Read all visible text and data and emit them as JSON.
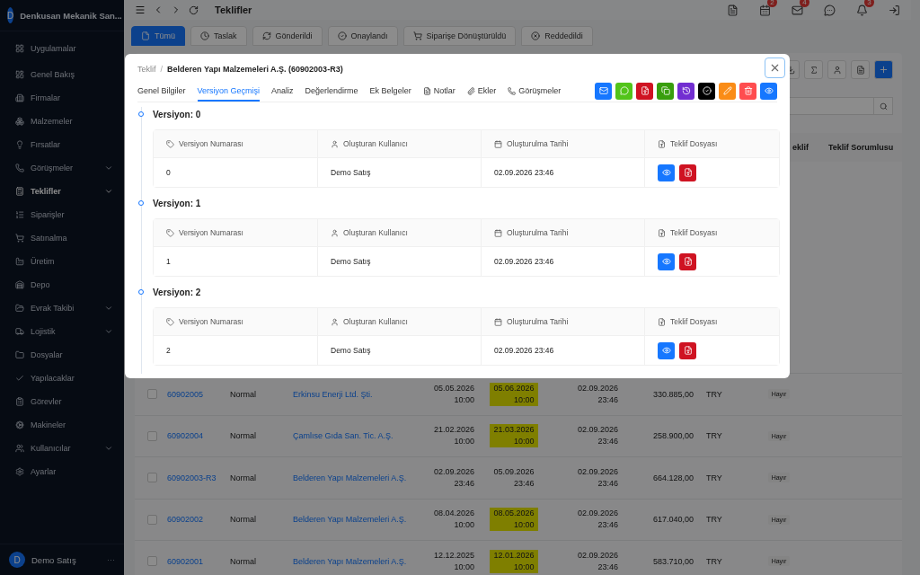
{
  "sidebar": {
    "company": {
      "avatar": "D",
      "name": "Denkusan Mekanik San..."
    },
    "items": [
      {
        "label": "Uygulamalar",
        "expandable": false,
        "selected": false
      },
      {
        "label": "Genel Bakış",
        "expandable": false,
        "selected": false
      },
      {
        "label": "Firmalar",
        "expandable": false,
        "selected": false
      },
      {
        "label": "Malzemeler",
        "expandable": false,
        "selected": false
      },
      {
        "label": "Fırsatlar",
        "expandable": false,
        "selected": false
      },
      {
        "label": "Görüşmeler",
        "expandable": true,
        "selected": false
      },
      {
        "label": "Teklifler",
        "expandable": true,
        "selected": true
      },
      {
        "label": "Siparişler",
        "expandable": false,
        "selected": false
      },
      {
        "label": "Satınalma",
        "expandable": false,
        "selected": false
      },
      {
        "label": "Üretim",
        "expandable": false,
        "selected": false
      },
      {
        "label": "Depo",
        "expandable": false,
        "selected": false
      },
      {
        "label": "Evrak Takibi",
        "expandable": true,
        "selected": false
      },
      {
        "label": "Lojistik",
        "expandable": true,
        "selected": false
      },
      {
        "label": "Dosyalar",
        "expandable": false,
        "selected": false
      },
      {
        "label": "Yapılacaklar",
        "expandable": false,
        "selected": false
      },
      {
        "label": "Görevler",
        "expandable": false,
        "selected": false
      },
      {
        "label": "Makineler",
        "expandable": false,
        "selected": false
      },
      {
        "label": "Kullanıcılar",
        "expandable": true,
        "selected": false
      },
      {
        "label": "Ayarlar",
        "expandable": false,
        "selected": false
      }
    ],
    "user": {
      "avatar": "D",
      "name": "Demo Satış",
      "more": "···"
    }
  },
  "topbar": {
    "title": "Teklifler",
    "icons": [
      {
        "kind": "document"
      },
      {
        "kind": "calendar",
        "badge": "2"
      },
      {
        "kind": "mail",
        "badge": "4"
      },
      {
        "kind": "chat"
      },
      {
        "kind": "bell",
        "badge": "3"
      },
      {
        "kind": "exit"
      }
    ]
  },
  "status_tabs": [
    {
      "label": "Tümü",
      "selected": true
    },
    {
      "label": "Taslak",
      "selected": false
    },
    {
      "label": "Gönderildi",
      "selected": false
    },
    {
      "label": "Onaylandı",
      "selected": false
    },
    {
      "label": "Siparişe Dönüştürüldü",
      "selected": false
    },
    {
      "label": "Reddedildi",
      "selected": false
    }
  ],
  "table": {
    "columns": [
      "eklif",
      "Teklif Sorumlusu"
    ],
    "rows": [
      {
        "checked": false,
        "number": "60902005",
        "type": "Normal",
        "company": "Erkinsu Enerji Ltd. Şti.",
        "date_1": "05.05.2026",
        "time_1": "10:00",
        "date_2": "05.06.2026",
        "time_2": "10:00",
        "highlighted": true,
        "date_3": "02.09.2026",
        "time_3": "23:46",
        "amount": "330.885,00",
        "currency": "TRY",
        "flag": "Hayır"
      },
      {
        "checked": false,
        "number": "60902004",
        "type": "Normal",
        "company": "Çamlıse Gıda San. Tic. A.Ş.",
        "date_1": "21.02.2026",
        "time_1": "10:00",
        "date_2": "21.03.2026",
        "time_2": "10:00",
        "highlighted": true,
        "date_3": "02.09.2026",
        "time_3": "23:46",
        "amount": "258.900,00",
        "currency": "TRY",
        "flag": "Hayır"
      },
      {
        "checked": false,
        "number": "60902003-R3",
        "type": "Normal",
        "company": "Belderen Yapı Malzemeleri A.Ş.",
        "date_1": "02.09.2026",
        "time_1": "23:46",
        "date_2": "05.09.2026",
        "time_2": "23:46",
        "highlighted": false,
        "date_3": "02.09.2026",
        "time_3": "23:46",
        "amount": "664.128,00",
        "currency": "TRY",
        "flag": "Hayır"
      },
      {
        "checked": false,
        "number": "60902002",
        "type": "Normal",
        "company": "Belderen Yapı Malzemeleri A.Ş.",
        "date_1": "08.04.2026",
        "time_1": "10:00",
        "date_2": "08.05.2026",
        "time_2": "10:00",
        "highlighted": true,
        "date_3": "02.09.2026",
        "time_3": "23:46",
        "amount": "617.040,00",
        "currency": "TRY",
        "flag": "Hayır"
      },
      {
        "checked": false,
        "number": "60902001",
        "type": "Normal",
        "company": "Belderen Yapı Malzemeleri A.Ş.",
        "date_1": "12.12.2025",
        "time_1": "10:00",
        "date_2": "12.01.2026",
        "time_2": "10:00",
        "highlighted": true,
        "date_3": "02.09.2026",
        "time_3": "23:46",
        "amount": "583.710,00",
        "currency": "TRY",
        "flag": "Hayır"
      }
    ]
  },
  "modal": {
    "breadcrumb": {
      "parent": "Teklif",
      "separator": "/",
      "current": "Belderen Yapı Malzemeleri A.Ş. (60902003-R3)"
    },
    "tabs": [
      {
        "label": "Genel Bilgiler",
        "selected": false
      },
      {
        "label": "Versiyon Geçmişi",
        "selected": true
      },
      {
        "label": "Analiz",
        "selected": false
      },
      {
        "label": "Değerlendirme",
        "selected": false
      },
      {
        "label": "Ek Belgeler",
        "selected": false
      },
      {
        "label": "Notlar",
        "selected": false
      },
      {
        "label": "Ekler",
        "selected": false
      },
      {
        "label": "Görüşmeler",
        "selected": false
      }
    ],
    "actions": [
      {
        "color": "#1677ff"
      },
      {
        "color": "#52c41a"
      },
      {
        "color": "#cf1322"
      },
      {
        "color": "#389e0d"
      },
      {
        "color": "#722ed1"
      },
      {
        "color": "#000000"
      },
      {
        "color": "#fa8c16"
      },
      {
        "color": "#ff4d4f"
      },
      {
        "color": "#1677ff"
      }
    ],
    "versions": [
      {
        "title": "Versiyon: 0",
        "columns": [
          "Versiyon Numarası",
          "Oluşturan Kullanıcı",
          "Oluşturulma Tarihi",
          "Teklif Dosyası"
        ],
        "row": {
          "number": "0",
          "user": "Demo Satış",
          "date": "02.09.2026 23:46"
        }
      },
      {
        "title": "Versiyon: 1",
        "columns": [
          "Versiyon Numarası",
          "Oluşturan Kullanıcı",
          "Oluşturulma Tarihi",
          "Teklif Dosyası"
        ],
        "row": {
          "number": "1",
          "user": "Demo Satış",
          "date": "02.09.2026 23:46"
        }
      },
      {
        "title": "Versiyon: 2",
        "columns": [
          "Versiyon Numarası",
          "Oluşturan Kullanıcı",
          "Oluşturulma Tarihi",
          "Teklif Dosyası"
        ],
        "row": {
          "number": "2",
          "user": "Demo Satış",
          "date": "02.09.2026 23:46"
        }
      }
    ]
  }
}
